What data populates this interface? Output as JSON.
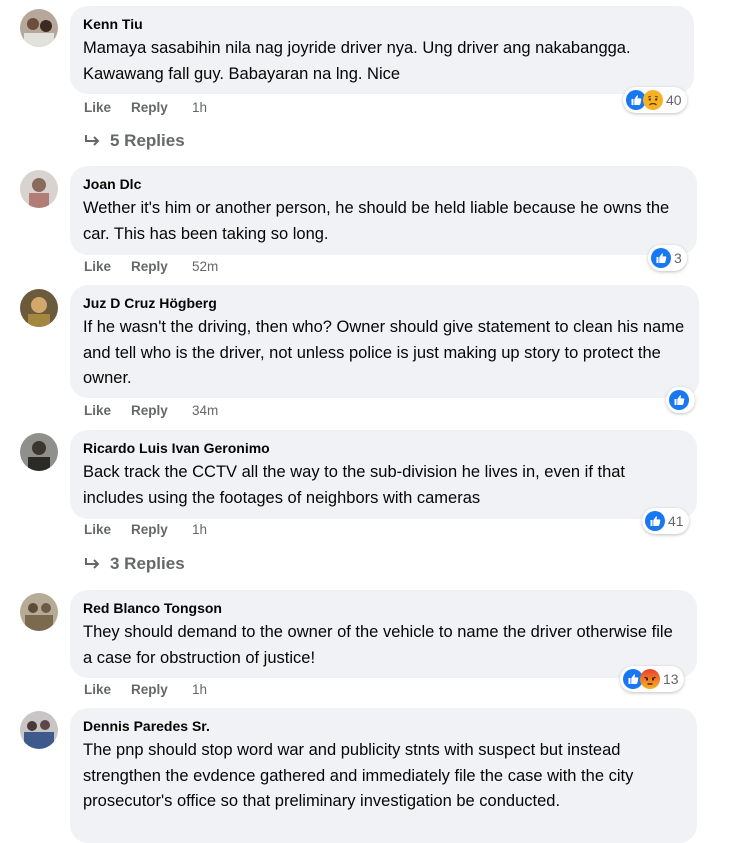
{
  "actions": {
    "like": "Like",
    "reply": "Reply"
  },
  "colors": {
    "like_blue": "#1877f2",
    "haha_yellow": "#f7b125",
    "angry_orange": "#e9710f",
    "text_gray": "#65676b",
    "bubble_bg": "#f0f2f5"
  },
  "comments": [
    {
      "author": "Kenn Tiu",
      "text": "Mamaya sasabihin nila nag joyride driver nya. Ung driver ang nakabangga. Kawawang fall guy. Babayaran na lng. Nice",
      "time": "1h",
      "reactions": [
        "like-icon",
        "sad-icon"
      ],
      "reaction_count": "40",
      "replies": "5 Replies"
    },
    {
      "author": "Joan Dlc",
      "text": "Wether it's him or another person, he should be held liable because he owns the car. This has been taking so long.",
      "time": "52m",
      "reactions": [
        "like-icon"
      ],
      "reaction_count": "3"
    },
    {
      "author": "Juz D Cruz Högberg",
      "text": "If he wasn't the driving, then who? Owner should give statement to clean his name and tell who is the driver, not unless police is just making up story to protect the owner.",
      "time": "34m",
      "reactions": [
        "like-icon"
      ],
      "reaction_count": ""
    },
    {
      "author": "Ricardo Luis Ivan Geronimo",
      "text": "Back track the CCTV all the way to the sub-division he lives in, even if that includes using the footages of neighbors with cameras",
      "time": "1h",
      "reactions": [
        "like-icon"
      ],
      "reaction_count": "41",
      "replies": "3 Replies"
    },
    {
      "author": "Red Blanco Tongson",
      "text": "They should demand to the owner of the vehicle to name the driver otherwise file a case for obstruction of justice!",
      "time": "1h",
      "reactions": [
        "like-icon",
        "angry-icon"
      ],
      "reaction_count": "13"
    },
    {
      "author": "Dennis Paredes Sr.",
      "text": "The pnp should stop word war and publicity stnts with suspect but instead strengthen the evdence gathered and immediately file the case with the city prosecutor's office so that preliminary investigation be conducted."
    }
  ]
}
